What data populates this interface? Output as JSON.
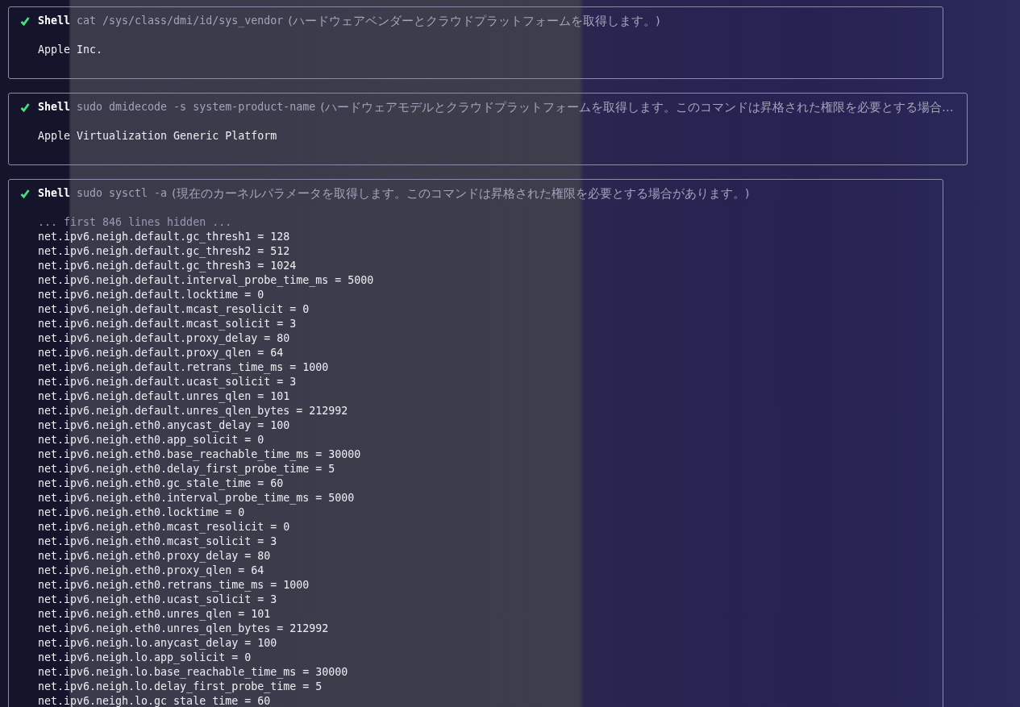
{
  "blocks": [
    {
      "succeeded": true,
      "tool": "Shell",
      "command": "cat /sys/class/dmi/id/sys_vendor",
      "description": "(ハードウェアベンダーとクラウドプラットフォームを取得します。)",
      "output": [
        {
          "kind": "text",
          "text": "Apple Inc."
        }
      ]
    },
    {
      "succeeded": true,
      "tool": "Shell",
      "command": "sudo dmidecode -s system-product-name",
      "description": "(ハードウェアモデルとクラウドプラットフォームを取得します。このコマンドは昇格された権限を必要とする場合…",
      "output": [
        {
          "kind": "text",
          "text": "Apple Virtualization Generic Platform"
        }
      ]
    },
    {
      "succeeded": true,
      "tool": "Shell",
      "command": "sudo sysctl -a",
      "description": "(現在のカーネルパラメータを取得します。このコマンドは昇格された権限を必要とする場合があります。)",
      "output": [
        {
          "kind": "hidden",
          "text": "... first 846 lines hidden ..."
        },
        {
          "kind": "text",
          "text": "net.ipv6.neigh.default.gc_thresh1 = 128"
        },
        {
          "kind": "text",
          "text": "net.ipv6.neigh.default.gc_thresh2 = 512"
        },
        {
          "kind": "text",
          "text": "net.ipv6.neigh.default.gc_thresh3 = 1024"
        },
        {
          "kind": "text",
          "text": "net.ipv6.neigh.default.interval_probe_time_ms = 5000"
        },
        {
          "kind": "text",
          "text": "net.ipv6.neigh.default.locktime = 0"
        },
        {
          "kind": "text",
          "text": "net.ipv6.neigh.default.mcast_resolicit = 0"
        },
        {
          "kind": "text",
          "text": "net.ipv6.neigh.default.mcast_solicit = 3"
        },
        {
          "kind": "text",
          "text": "net.ipv6.neigh.default.proxy_delay = 80"
        },
        {
          "kind": "text",
          "text": "net.ipv6.neigh.default.proxy_qlen = 64"
        },
        {
          "kind": "text",
          "text": "net.ipv6.neigh.default.retrans_time_ms = 1000"
        },
        {
          "kind": "text",
          "text": "net.ipv6.neigh.default.ucast_solicit = 3"
        },
        {
          "kind": "text",
          "text": "net.ipv6.neigh.default.unres_qlen = 101"
        },
        {
          "kind": "text",
          "text": "net.ipv6.neigh.default.unres_qlen_bytes = 212992"
        },
        {
          "kind": "text",
          "text": "net.ipv6.neigh.eth0.anycast_delay = 100"
        },
        {
          "kind": "text",
          "text": "net.ipv6.neigh.eth0.app_solicit = 0"
        },
        {
          "kind": "text",
          "text": "net.ipv6.neigh.eth0.base_reachable_time_ms = 30000"
        },
        {
          "kind": "text",
          "text": "net.ipv6.neigh.eth0.delay_first_probe_time = 5"
        },
        {
          "kind": "text",
          "text": "net.ipv6.neigh.eth0.gc_stale_time = 60"
        },
        {
          "kind": "text",
          "text": "net.ipv6.neigh.eth0.interval_probe_time_ms = 5000"
        },
        {
          "kind": "text",
          "text": "net.ipv6.neigh.eth0.locktime = 0"
        },
        {
          "kind": "text",
          "text": "net.ipv6.neigh.eth0.mcast_resolicit = 0"
        },
        {
          "kind": "text",
          "text": "net.ipv6.neigh.eth0.mcast_solicit = 3"
        },
        {
          "kind": "text",
          "text": "net.ipv6.neigh.eth0.proxy_delay = 80"
        },
        {
          "kind": "text",
          "text": "net.ipv6.neigh.eth0.proxy_qlen = 64"
        },
        {
          "kind": "text",
          "text": "net.ipv6.neigh.eth0.retrans_time_ms = 1000"
        },
        {
          "kind": "text",
          "text": "net.ipv6.neigh.eth0.ucast_solicit = 3"
        },
        {
          "kind": "text",
          "text": "net.ipv6.neigh.eth0.unres_qlen = 101"
        },
        {
          "kind": "text",
          "text": "net.ipv6.neigh.eth0.unres_qlen_bytes = 212992"
        },
        {
          "kind": "text",
          "text": "net.ipv6.neigh.lo.anycast_delay = 100"
        },
        {
          "kind": "text",
          "text": "net.ipv6.neigh.lo.app_solicit = 0"
        },
        {
          "kind": "text",
          "text": "net.ipv6.neigh.lo.base_reachable_time_ms = 30000"
        },
        {
          "kind": "text",
          "text": "net.ipv6.neigh.lo.delay_first_probe_time = 5"
        },
        {
          "kind": "text",
          "text": "net.ipv6.neigh.lo.gc_stale_time = 60"
        }
      ]
    }
  ]
}
